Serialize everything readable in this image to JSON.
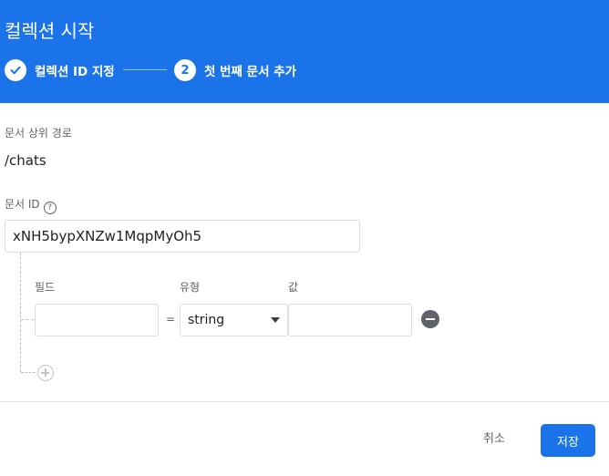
{
  "header": {
    "title": "컬렉션 시작",
    "steps": [
      {
        "label": "컬렉션 ID 지정",
        "status": "completed"
      },
      {
        "number": "2",
        "label": "첫 번째 문서 추가",
        "status": "active"
      }
    ]
  },
  "parent_path": {
    "label": "문서 상위 경로",
    "value": "/chats"
  },
  "document_id": {
    "label": "문서 ID",
    "help_icon": "?",
    "value": "xNH5bypXNZw1MqpMyOh5"
  },
  "field_table": {
    "headers": {
      "field": "필드",
      "type": "유형",
      "value": "값"
    },
    "rows": [
      {
        "field": "",
        "equals": "=",
        "type": "string",
        "value": ""
      }
    ]
  },
  "footer": {
    "cancel_label": "취소",
    "save_label": "저장"
  },
  "colors": {
    "accent": "#1a73e8"
  }
}
